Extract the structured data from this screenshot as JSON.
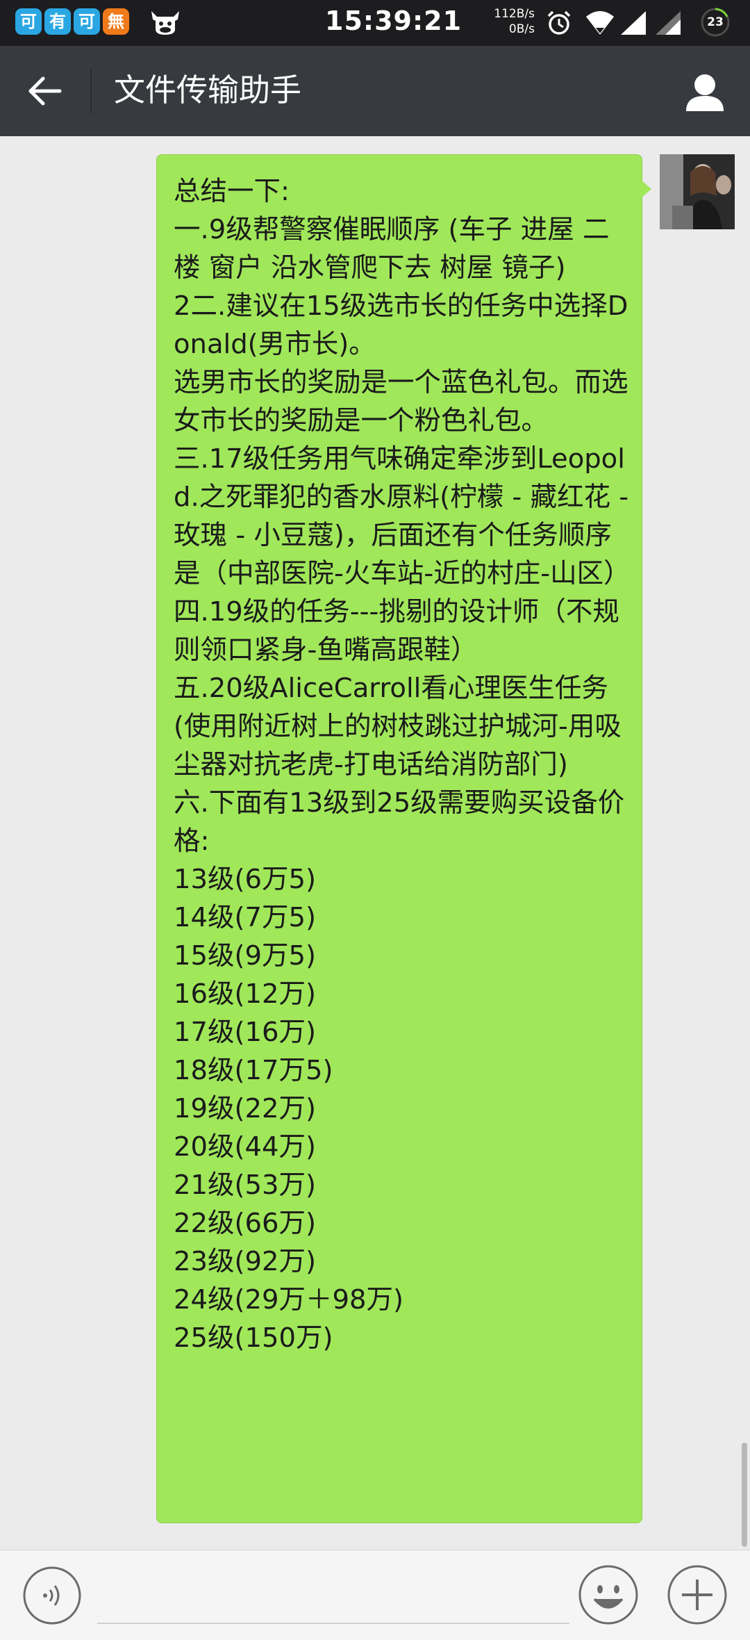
{
  "status_bar": {
    "app_icons": [
      {
        "name": "ke-icon",
        "glyph": "可",
        "color": "#2aa7e3"
      },
      {
        "name": "you-icon",
        "glyph": "有",
        "color": "#2aa7e3"
      },
      {
        "name": "ke-icon-2",
        "glyph": "可",
        "color": "#2aa7e3"
      },
      {
        "name": "wu-icon",
        "glyph": "無",
        "color": "#f07a1a"
      }
    ],
    "time": "15:39:21",
    "speed_up": "112B/s",
    "speed_down": "0B/s",
    "battery": "23"
  },
  "header": {
    "title": "文件传输助手",
    "back_icon": "arrow-left-icon",
    "profile_icon": "person-icon"
  },
  "message": {
    "text": "总结一下:\n一.9级帮警察催眠顺序 (车子 进屋 二楼 窗户 沿水管爬下去 树屋 镜子)\n2二.建议在15级选市长的任务中选择Donald(男市长)。\n选男市长的奖励是一个蓝色礼包。而选女市长的奖励是一个粉色礼包。\n三.17级任务用气味确定牵涉到Leopold.之死罪犯的香水原料(柠檬 - 藏红花 - 玫瑰 - 小豆蔻)，后面还有个任务顺序是（中部医院-火车站-近的村庄-山区）\n四.19级的任务---挑剔的设计师（不规则领口紧身-鱼嘴高跟鞋）\n五.20级AliceCarroll看心理医生任务(使用附近树上的树枝跳过护城河-用吸尘器对抗老虎-打电话给消防部门)\n六.下面有13级到25级需要购买设备价格:\n13级(6万5)\n14级(7万5)\n15级(9万5)\n16级(12万)\n17级(16万)\n18级(17万5)\n19级(22万)\n20级(44万)\n21级(53万)\n22级(66万)\n23级(92万)\n24级(29万＋98万)\n25级(150万)"
  },
  "colors": {
    "status_bar": "#1d1d1f",
    "title_bar": "#373a3f",
    "chat_bg": "#ebebeb",
    "bubble": "#a0e75a",
    "input_bar": "#f5f5f5"
  },
  "input_bar": {
    "voice_icon": "voice-icon",
    "emoji_icon": "emoji-icon",
    "plus_icon": "plus-icon"
  }
}
